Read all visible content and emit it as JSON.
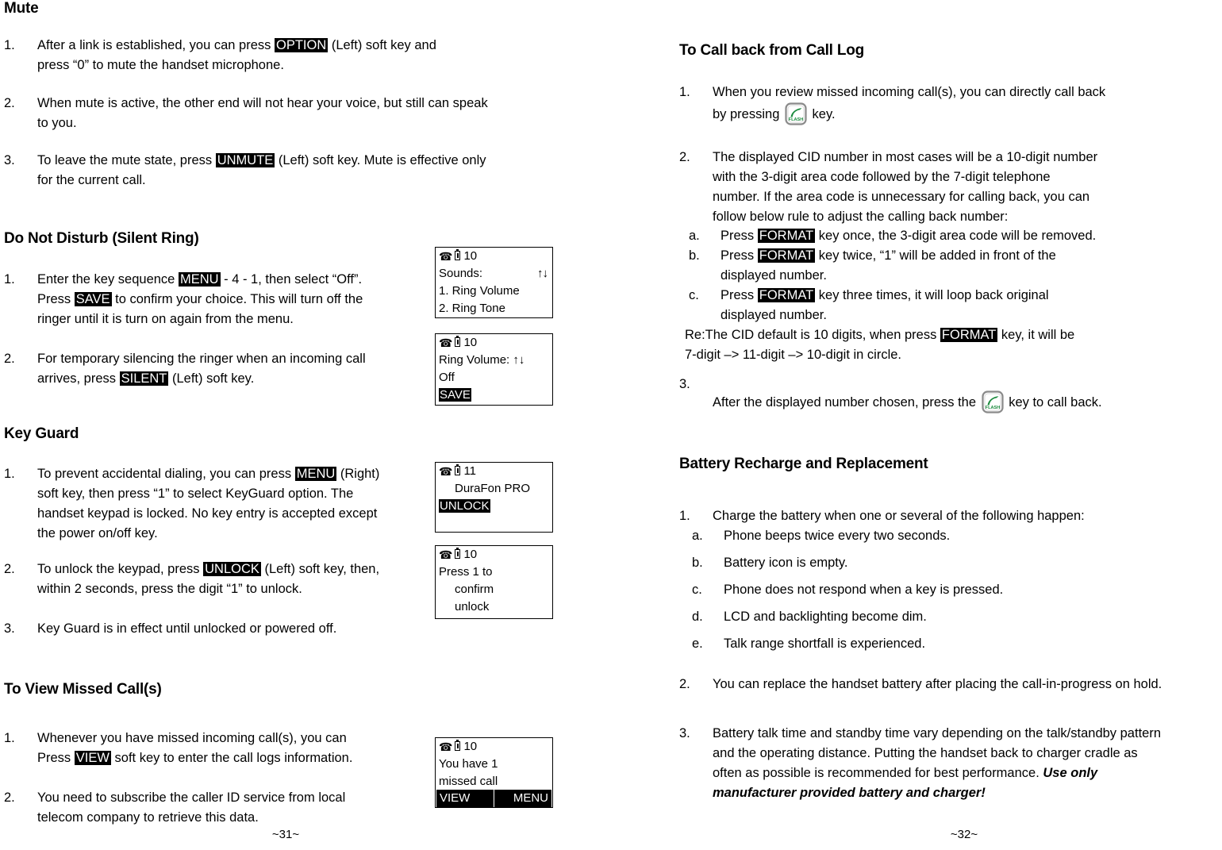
{
  "document": {
    "left_page_number": "~31~",
    "right_page_number": "~32~"
  },
  "icons": {
    "phone_glyph": "☎",
    "flash_key_label": "FLASH",
    "flash_key_color": "#1a8a3c",
    "up_down_arrows": "↑↓"
  },
  "left_column": {
    "sections": [
      {
        "heading": "Mute",
        "items": [
          {
            "num": "1.",
            "parts": [
              {
                "t": "After a link is established, you can press "
              },
              {
                "t": "OPTION",
                "style": "key"
              },
              {
                "t": " (Left) soft key and"
              },
              {
                "t": "\n"
              },
              {
                "t": "press “0” to mute the handset microphone."
              }
            ]
          },
          {
            "num": "2.",
            "parts": [
              {
                "t": "When mute is active, the other end will not hear your voice, but still can speak"
              },
              {
                "t": "\n"
              },
              {
                "t": "to you."
              }
            ]
          },
          {
            "num": "3.",
            "parts": [
              {
                "t": "To leave the mute state, press "
              },
              {
                "t": "UNMUTE",
                "style": "key"
              },
              {
                "t": " (Left) soft key. Mute is effective only"
              },
              {
                "t": "\n"
              },
              {
                "t": "for the current call."
              }
            ]
          }
        ]
      },
      {
        "heading": "Do Not Disturb (Silent Ring)",
        "items": [
          {
            "num": "1.",
            "parts": [
              {
                "t": "Enter the key sequence "
              },
              {
                "t": "MENU",
                "style": "key"
              },
              {
                "t": " - 4 - 1, then select “Off”."
              },
              {
                "t": "\n"
              },
              {
                "t": "Press "
              },
              {
                "t": "SAVE",
                "style": "key"
              },
              {
                "t": " to confirm your choice. This will turn off the"
              },
              {
                "t": "\n"
              },
              {
                "t": "ringer until it is turn on again from the menu."
              }
            ]
          },
          {
            "num": "2.",
            "parts": [
              {
                "t": "For temporary silencing the ringer when an incoming call"
              },
              {
                "t": "\n"
              },
              {
                "t": "arrives, press "
              },
              {
                "t": "SILENT",
                "style": "key"
              },
              {
                "t": " (Left) soft key."
              }
            ]
          }
        ]
      },
      {
        "heading": "Key Guard",
        "items": [
          {
            "num": "1.",
            "parts": [
              {
                "t": "To prevent accidental dialing, you can press "
              },
              {
                "t": "MENU",
                "style": "key"
              },
              {
                "t": " (Right)"
              },
              {
                "t": "\n"
              },
              {
                "t": "soft key, then press “1” to select KeyGuard option.  The"
              },
              {
                "t": "\n"
              },
              {
                "t": "handset keypad is locked.  No key entry is accepted except"
              },
              {
                "t": "\n"
              },
              {
                "t": "the power on/off key."
              }
            ]
          },
          {
            "num": "2.",
            "parts": [
              {
                "t": "To unlock the keypad, press "
              },
              {
                "t": "UNLOCK",
                "style": "key"
              },
              {
                "t": " (Left) soft key, then,"
              },
              {
                "t": "\n"
              },
              {
                "t": "within 2 seconds, press the digit “1” to unlock."
              }
            ]
          },
          {
            "num": "3.",
            "parts": [
              {
                "t": "Key Guard is in effect until unlocked or powered off."
              }
            ]
          }
        ]
      },
      {
        "heading": "To View Missed Call(s)",
        "items": [
          {
            "num": "1.",
            "parts": [
              {
                "t": "Whenever you have missed incoming call(s), you can"
              },
              {
                "t": "\n"
              },
              {
                "t": "Press  "
              },
              {
                "t": "VIEW",
                "style": "key"
              },
              {
                "t": " soft key to enter the call logs information."
              }
            ]
          },
          {
            "num": "2.",
            "parts": [
              {
                "t": "You need to subscribe the caller ID service from local"
              },
              {
                "t": "\n"
              },
              {
                "t": "telecom company to retrieve this data."
              }
            ]
          }
        ]
      }
    ],
    "lcd_screens": [
      {
        "name": "sounds-menu",
        "status_number": "10",
        "lines": [
          {
            "text": "Sounds:",
            "arrows": true
          },
          {
            "text": "1. Ring Volume"
          },
          {
            "text": "2. Ring Tone"
          }
        ]
      },
      {
        "name": "ring-volume",
        "status_number": "10",
        "lines": [
          {
            "text": "Ring Volume:",
            "arrows_inline": true
          },
          {
            "text": "Off"
          },
          {
            "text": "SAVE",
            "inverted": true
          }
        ]
      },
      {
        "name": "keyguard-locked",
        "status_number": "11",
        "lines": [
          {
            "text": "DuraFon PRO",
            "indent": true
          },
          {
            "text": ""
          },
          {
            "text": "UNLOCK",
            "inverted": true
          }
        ]
      },
      {
        "name": "confirm-unlock",
        "status_number": "10",
        "lines": [
          {
            "text": "Press 1 to"
          },
          {
            "text": "confirm",
            "indent": true
          },
          {
            "text": "unlock",
            "indent": true
          }
        ]
      },
      {
        "name": "missed-call",
        "status_number": "10",
        "lines": [
          {
            "text": "You have 1"
          },
          {
            "text": "missed call"
          }
        ],
        "softkeys": {
          "left": "VIEW",
          "right": "MENU"
        }
      }
    ]
  },
  "right_column": {
    "sections": [
      {
        "heading": "To Call back from Call Log",
        "items": [
          {
            "num": "1.",
            "parts": [
              {
                "t": "When you review missed incoming call(s), you can directly call back"
              },
              {
                "t": "\n"
              },
              {
                "t": "by pressing "
              },
              {
                "t": "",
                "style": "flashkey"
              },
              {
                "t": " key."
              }
            ]
          },
          {
            "num": "2.",
            "parts": [
              {
                "t": "The displayed CID number in most cases will be a 10-digit number"
              },
              {
                "t": "\n"
              },
              {
                "t": "with the 3-digit area code followed by the 7-digit telephone"
              },
              {
                "t": "\n"
              },
              {
                "t": "number. If the area code is unnecessary for calling back, you can"
              },
              {
                "t": "\n"
              },
              {
                "t": "follow below rule to adjust the calling back number:"
              }
            ]
          }
        ],
        "subitems": [
          {
            "num": "a.",
            "parts": [
              {
                "t": "Press "
              },
              {
                "t": "FORMAT",
                "style": "key"
              },
              {
                "t": " key once, the 3-digit area code will be removed."
              }
            ]
          },
          {
            "num": "b.",
            "parts": [
              {
                "t": "Press "
              },
              {
                "t": "FORMAT",
                "style": "key"
              },
              {
                "t": " key twice, “1” will be added in front of the"
              },
              {
                "t": "\n"
              },
              {
                "t": "displayed number."
              }
            ]
          },
          {
            "num": "c.",
            "parts": [
              {
                "t": "Press "
              },
              {
                "t": "FORMAT",
                "style": "key"
              },
              {
                "t": " key three times, it will loop back original"
              },
              {
                "t": "\n"
              },
              {
                "t": "displayed number."
              }
            ]
          }
        ],
        "note": [
          {
            "t": "Re:The CID default is 10 digits,  when press "
          },
          {
            "t": "FORMAT",
            "style": "key"
          },
          {
            "t": " key, it will be"
          },
          {
            "t": "\n"
          },
          {
            "t": "   7-digit –> 11-digit –> 10-digit in circle."
          }
        ],
        "item3": {
          "num": "3.",
          "parts": [
            {
              "t": "After the displayed number chosen, press the "
            },
            {
              "t": "",
              "style": "flashkey"
            },
            {
              "t": " key to call back."
            }
          ]
        }
      },
      {
        "heading": "Battery Recharge and Replacement",
        "items": [
          {
            "num": "1.",
            "parts": [
              {
                "t": "Charge the battery when one or several of the following happen:"
              }
            ]
          }
        ],
        "subitems": [
          {
            "num": "a.",
            "parts": [
              {
                "t": "Phone beeps twice every two seconds."
              }
            ]
          },
          {
            "num": "b.",
            "parts": [
              {
                "t": "Battery icon is empty."
              }
            ]
          },
          {
            "num": "c.",
            "parts": [
              {
                "t": "Phone does not respond when a key is pressed."
              }
            ]
          },
          {
            "num": "d.",
            "parts": [
              {
                "t": "LCD and backlighting become dim."
              }
            ]
          },
          {
            "num": "e.",
            "parts": [
              {
                "t": "Talk range shortfall is experienced."
              }
            ]
          }
        ],
        "item2": {
          "num": "2.",
          "parts": [
            {
              "t": "You can replace the handset battery after placing the call-in-progress on hold."
            }
          ]
        },
        "item3": {
          "num": "3.",
          "parts": [
            {
              "t": "Battery talk time and standby time vary depending on the talk/standby pattern"
            },
            {
              "t": "\n"
            },
            {
              "t": "and the operating distance.  Putting the handset back to charger cradle as"
            },
            {
              "t": "\n"
            },
            {
              "t": "often as possible is recommended for best performance. "
            },
            {
              "t": "Use only",
              "style": "bolditalic"
            },
            {
              "t": "\n"
            },
            {
              "t": "manufacturer provided battery and charger!",
              "style": "bolditalic"
            }
          ]
        }
      }
    ]
  }
}
